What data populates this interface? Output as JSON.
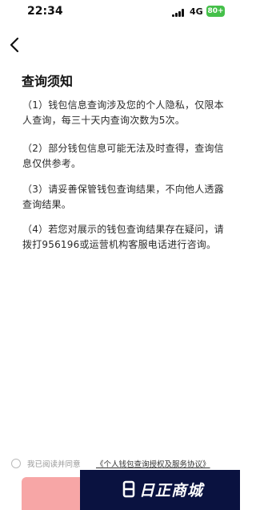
{
  "status_bar": {
    "time": "22:34",
    "network": "4G",
    "battery": "80+"
  },
  "page": {
    "title": "查询须知",
    "paragraphs": [
      "（1）钱包信息查询涉及您的个人隐私，仅限本人查询，每三十天内查询次数为5次。",
      "（2）部分钱包信息可能无法及时查得，查询信息仅供参考。",
      "（3）请妥善保管钱包查询结果，不向他人透露查询结果。",
      "（4）若您对展示的钱包查询结果存在疑问，请拨打956196或运营机构客服电话进行咨询。"
    ]
  },
  "agreement": {
    "prefix": "我已阅读并同意",
    "link": "《个人钱包查询授权及服务协议》"
  },
  "watermark": {
    "text": "日正商城"
  },
  "colors": {
    "battery": "#45c04a",
    "submit_button": "#f7a6a6",
    "watermark_bg": "#0a1240"
  }
}
